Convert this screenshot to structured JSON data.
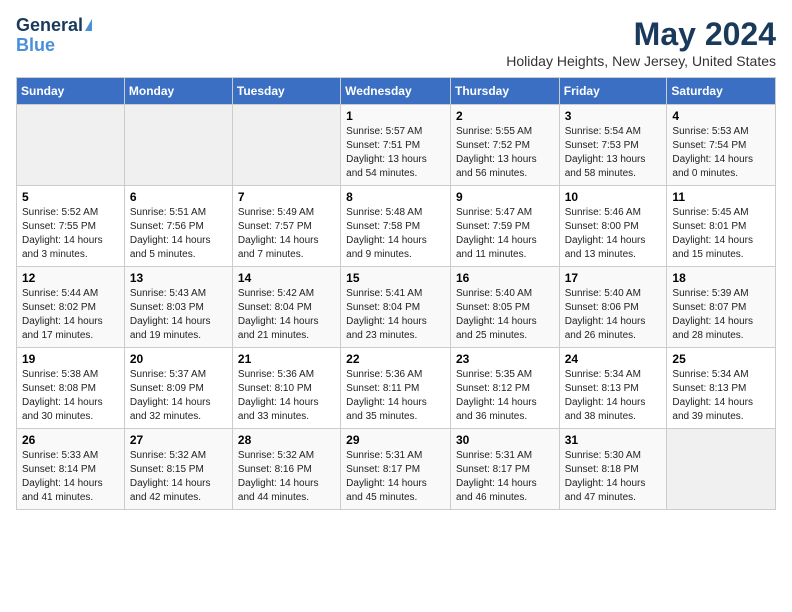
{
  "logo": {
    "general": "General",
    "blue": "Blue"
  },
  "header": {
    "month_year": "May 2024",
    "location": "Holiday Heights, New Jersey, United States"
  },
  "weekdays": [
    "Sunday",
    "Monday",
    "Tuesday",
    "Wednesday",
    "Thursday",
    "Friday",
    "Saturday"
  ],
  "weeks": [
    [
      {
        "day": "",
        "empty": true
      },
      {
        "day": "",
        "empty": true
      },
      {
        "day": "",
        "empty": true
      },
      {
        "day": "1",
        "sunrise": "5:57 AM",
        "sunset": "7:51 PM",
        "daylight": "13 hours and 54 minutes."
      },
      {
        "day": "2",
        "sunrise": "5:55 AM",
        "sunset": "7:52 PM",
        "daylight": "13 hours and 56 minutes."
      },
      {
        "day": "3",
        "sunrise": "5:54 AM",
        "sunset": "7:53 PM",
        "daylight": "13 hours and 58 minutes."
      },
      {
        "day": "4",
        "sunrise": "5:53 AM",
        "sunset": "7:54 PM",
        "daylight": "14 hours and 0 minutes."
      }
    ],
    [
      {
        "day": "5",
        "sunrise": "5:52 AM",
        "sunset": "7:55 PM",
        "daylight": "14 hours and 3 minutes."
      },
      {
        "day": "6",
        "sunrise": "5:51 AM",
        "sunset": "7:56 PM",
        "daylight": "14 hours and 5 minutes."
      },
      {
        "day": "7",
        "sunrise": "5:49 AM",
        "sunset": "7:57 PM",
        "daylight": "14 hours and 7 minutes."
      },
      {
        "day": "8",
        "sunrise": "5:48 AM",
        "sunset": "7:58 PM",
        "daylight": "14 hours and 9 minutes."
      },
      {
        "day": "9",
        "sunrise": "5:47 AM",
        "sunset": "7:59 PM",
        "daylight": "14 hours and 11 minutes."
      },
      {
        "day": "10",
        "sunrise": "5:46 AM",
        "sunset": "8:00 PM",
        "daylight": "14 hours and 13 minutes."
      },
      {
        "day": "11",
        "sunrise": "5:45 AM",
        "sunset": "8:01 PM",
        "daylight": "14 hours and 15 minutes."
      }
    ],
    [
      {
        "day": "12",
        "sunrise": "5:44 AM",
        "sunset": "8:02 PM",
        "daylight": "14 hours and 17 minutes."
      },
      {
        "day": "13",
        "sunrise": "5:43 AM",
        "sunset": "8:03 PM",
        "daylight": "14 hours and 19 minutes."
      },
      {
        "day": "14",
        "sunrise": "5:42 AM",
        "sunset": "8:04 PM",
        "daylight": "14 hours and 21 minutes."
      },
      {
        "day": "15",
        "sunrise": "5:41 AM",
        "sunset": "8:04 PM",
        "daylight": "14 hours and 23 minutes."
      },
      {
        "day": "16",
        "sunrise": "5:40 AM",
        "sunset": "8:05 PM",
        "daylight": "14 hours and 25 minutes."
      },
      {
        "day": "17",
        "sunrise": "5:40 AM",
        "sunset": "8:06 PM",
        "daylight": "14 hours and 26 minutes."
      },
      {
        "day": "18",
        "sunrise": "5:39 AM",
        "sunset": "8:07 PM",
        "daylight": "14 hours and 28 minutes."
      }
    ],
    [
      {
        "day": "19",
        "sunrise": "5:38 AM",
        "sunset": "8:08 PM",
        "daylight": "14 hours and 30 minutes."
      },
      {
        "day": "20",
        "sunrise": "5:37 AM",
        "sunset": "8:09 PM",
        "daylight": "14 hours and 32 minutes."
      },
      {
        "day": "21",
        "sunrise": "5:36 AM",
        "sunset": "8:10 PM",
        "daylight": "14 hours and 33 minutes."
      },
      {
        "day": "22",
        "sunrise": "5:36 AM",
        "sunset": "8:11 PM",
        "daylight": "14 hours and 35 minutes."
      },
      {
        "day": "23",
        "sunrise": "5:35 AM",
        "sunset": "8:12 PM",
        "daylight": "14 hours and 36 minutes."
      },
      {
        "day": "24",
        "sunrise": "5:34 AM",
        "sunset": "8:13 PM",
        "daylight": "14 hours and 38 minutes."
      },
      {
        "day": "25",
        "sunrise": "5:34 AM",
        "sunset": "8:13 PM",
        "daylight": "14 hours and 39 minutes."
      }
    ],
    [
      {
        "day": "26",
        "sunrise": "5:33 AM",
        "sunset": "8:14 PM",
        "daylight": "14 hours and 41 minutes."
      },
      {
        "day": "27",
        "sunrise": "5:32 AM",
        "sunset": "8:15 PM",
        "daylight": "14 hours and 42 minutes."
      },
      {
        "day": "28",
        "sunrise": "5:32 AM",
        "sunset": "8:16 PM",
        "daylight": "14 hours and 44 minutes."
      },
      {
        "day": "29",
        "sunrise": "5:31 AM",
        "sunset": "8:17 PM",
        "daylight": "14 hours and 45 minutes."
      },
      {
        "day": "30",
        "sunrise": "5:31 AM",
        "sunset": "8:17 PM",
        "daylight": "14 hours and 46 minutes."
      },
      {
        "day": "31",
        "sunrise": "5:30 AM",
        "sunset": "8:18 PM",
        "daylight": "14 hours and 47 minutes."
      },
      {
        "day": "",
        "empty": true
      }
    ]
  ],
  "labels": {
    "sunrise": "Sunrise:",
    "sunset": "Sunset:",
    "daylight": "Daylight:"
  }
}
